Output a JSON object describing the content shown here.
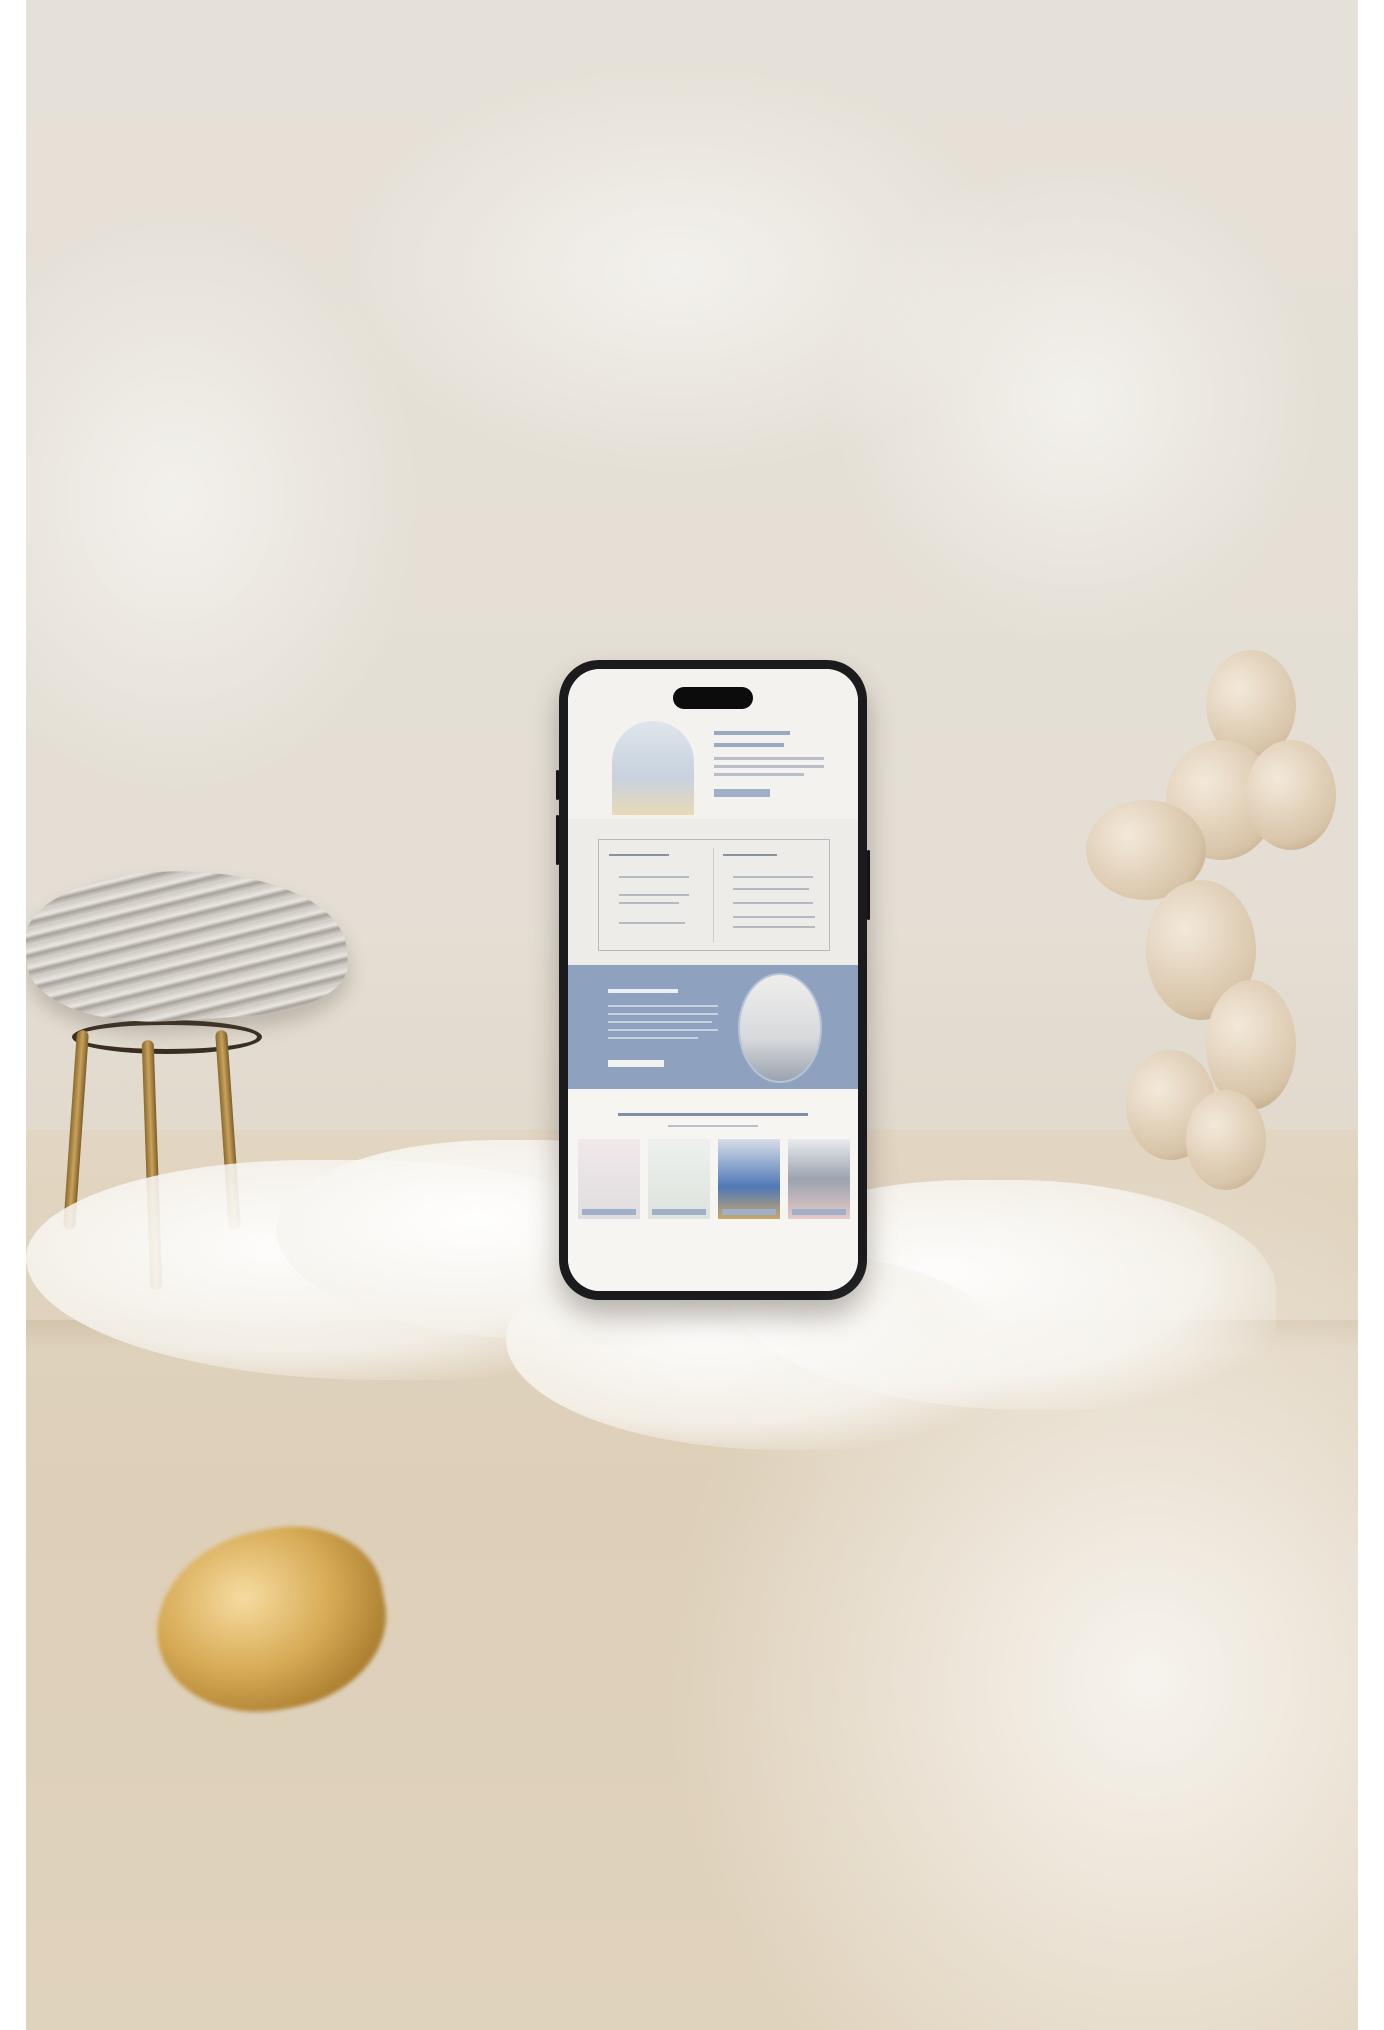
{
  "scene": {
    "description_colors": {
      "wall": "#e4ded4",
      "shelf": "#ddcfb8",
      "phone_body": "#1b1a1c",
      "accent_blue": "#8ea2c0",
      "gold": "#d7aa55"
    }
  },
  "phone_screen": {
    "hero_title": "",
    "sections": [
      "hero",
      "compare",
      "about",
      "ready"
    ],
    "ready_title": ""
  }
}
